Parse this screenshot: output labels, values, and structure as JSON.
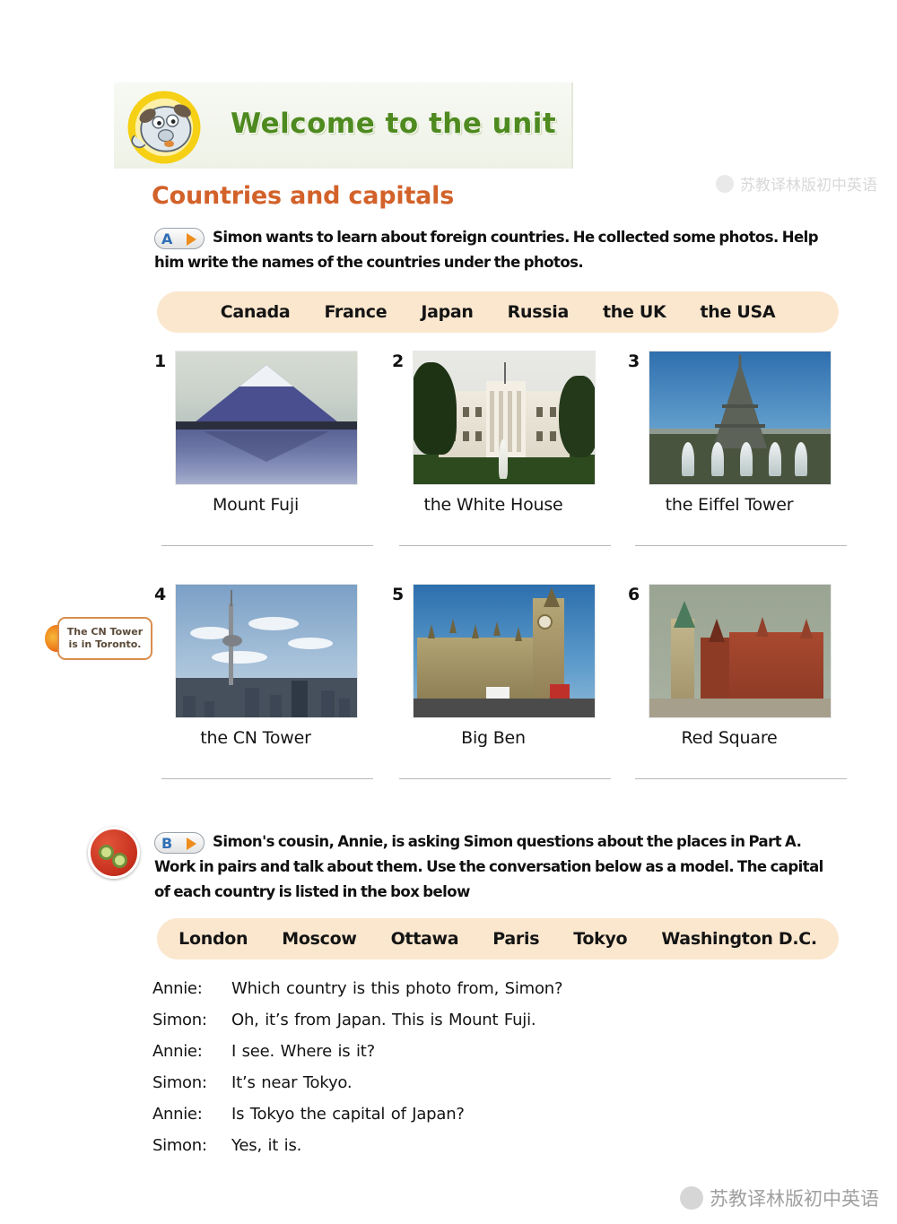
{
  "banner": {
    "title": "Welcome to the unit",
    "mascot_icon": "dog-mascot-icon"
  },
  "section": {
    "title": "Countries and capitals"
  },
  "part_a": {
    "badge_letter": "A",
    "instruction": "Simon wants to learn about foreign countries. He collected some photos. Help him write the names of the countries under the photos.",
    "word_bank": [
      "Canada",
      "France",
      "Japan",
      "Russia",
      "the UK",
      "the USA"
    ],
    "items": [
      {
        "number": "1",
        "caption": "Mount Fuji",
        "answer": ""
      },
      {
        "number": "2",
        "caption": "the White House",
        "answer": ""
      },
      {
        "number": "3",
        "caption": "the Eiffel Tower",
        "answer": ""
      },
      {
        "number": "4",
        "caption": "the CN  Tower",
        "answer": ""
      },
      {
        "number": "5",
        "caption": "Big Ben",
        "answer": ""
      },
      {
        "number": "6",
        "caption": "Red Square",
        "answer": ""
      }
    ]
  },
  "hint": {
    "text": "The CN Tower is in Toronto."
  },
  "part_b": {
    "badge_letter": "B",
    "icon": "pair-work-icon",
    "instruction": "Simon's cousin, Annie, is asking Simon questions about the places in Part A. Work in pairs and talk about them. Use the conversation below as a model. The capital of each country is listed in the box below",
    "word_bank": [
      "London",
      "Moscow",
      "Ottawa",
      "Paris",
      "Tokyo",
      "Washington D.C."
    ],
    "dialogue": [
      {
        "speaker": "Annie:",
        "text": "Which  country is this photo from, Simon?"
      },
      {
        "speaker": "Simon:",
        "text": "Oh, it’s from Japan. This is Mount Fuji."
      },
      {
        "speaker": "Annie:",
        "text": "I see. Where is it?"
      },
      {
        "speaker": "Simon:",
        "text": "It’s near Tokyo."
      },
      {
        "speaker": "Annie:",
        "text": "Is Tokyo the capital of Japan?"
      },
      {
        "speaker": "Simon:",
        "text": "Yes, it is."
      }
    ]
  },
  "watermarks": {
    "top": "苏教译林版初中英语",
    "bottom": "苏教译林版初中英语"
  },
  "colors": {
    "banner_title": "#4e8a1f",
    "section_title": "#d2622a",
    "word_bank_bg": "#fbe7ce",
    "badge_letter": "#2f6fb5",
    "badge_arrow": "#ee8c1c",
    "hint_border": "#d98e4e"
  }
}
